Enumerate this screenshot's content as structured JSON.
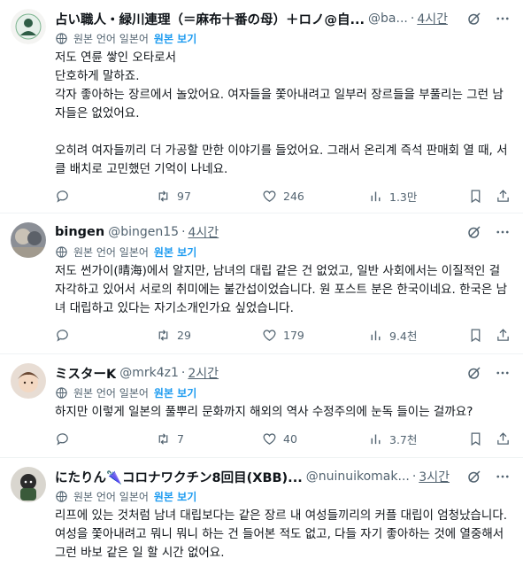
{
  "ui": {
    "translate_label": "원본 언어 일본어",
    "original_link": "원본 보기",
    "accent_color": "#1d9bf0",
    "muted_color": "#536471"
  },
  "tweets": [
    {
      "name": "占い職人・緑川連理（＝麻布十番の母）＋ロノ@自...",
      "handle": "@ba...",
      "time": "4시간",
      "body": "저도 연륜 쌓인 오타로서\n단호하게 말하죠.\n각자 좋아하는 장르에서 놀았어요. 여자들을 쫓아내려고 일부러 장르들을 부풀리는 그런 남자들은 없었어요.\n\n오히려 여자들끼리 더 가공할 만한 이야기를 들었어요. 그래서 온리계 즉석 판매회 열 때, 서클 배치로 고민했던 기억이 나네요.",
      "stats": {
        "replies": "",
        "retweets": "97",
        "likes": "246",
        "views": "1.3만"
      }
    },
    {
      "name": "bingen",
      "handle": "@bingen15",
      "time": "4시간",
      "body": "저도 썬가이(晴海)에서 알지만, 남녀의 대립 같은 건 없었고, 일반 사회에서는 이질적인 걸 자각하고 있어서 서로의 취미에는 불간섭이었습니다. 원 포스트 분은 한국이네요. 한국은 남녀 대립하고 있다는 자기소개인가요 싶었습니다.",
      "stats": {
        "replies": "",
        "retweets": "29",
        "likes": "179",
        "views": "9.4천"
      }
    },
    {
      "name": "ミスターK",
      "handle": "@mrk4z1",
      "time": "2시간",
      "body": "하지만 이렇게 일본의 풀뿌리 문화까지 해외의 역사 수정주의에 눈독 들이는 걸까요?",
      "stats": {
        "replies": "",
        "retweets": "7",
        "likes": "40",
        "views": "3.7천"
      }
    },
    {
      "name": "にたりん🌂コロナワクチン8回目(XBB)...",
      "handle": "@nuinuikomak...",
      "time": "3시간",
      "body": "리프에 있는 것처럼 남녀 대립보다는 같은 장르 내 여성들끼리의 커플 대립이 엄청났습니다. 여성을 쫓아내려고 뭐니 뭐니 하는 건 들어본 적도 없고, 다들 자기 좋아하는 것에 열중해서 그런 바보 같은 일 할 시간 없어요.",
      "stats": {
        "replies": "",
        "retweets": "",
        "likes": "",
        "views": ""
      }
    }
  ]
}
